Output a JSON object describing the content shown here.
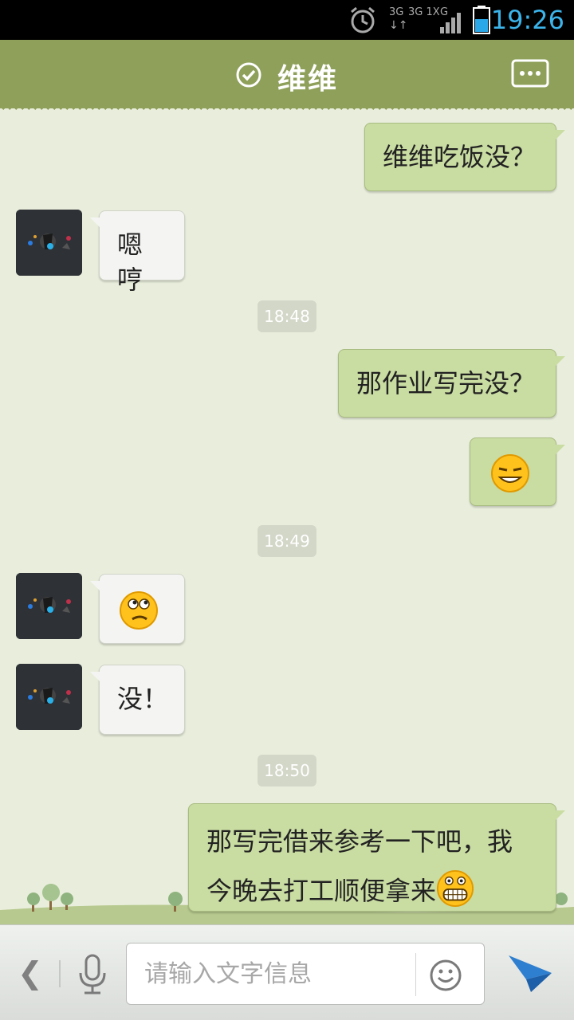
{
  "status_bar": {
    "time": "19:26",
    "network_3g": "3G",
    "network_3g_1x": "3G 1X",
    "network_g": "G"
  },
  "header": {
    "title": "维维"
  },
  "messages": [
    {
      "side": "right",
      "text": "维维吃饭没？"
    },
    {
      "side": "left",
      "text": "嗯哼"
    },
    {
      "timestamp": "18:48"
    },
    {
      "side": "right",
      "text": "那作业写完没？"
    },
    {
      "side": "right",
      "emoji": "smirk"
    },
    {
      "timestamp": "18:49"
    },
    {
      "side": "left",
      "emoji": "confused"
    },
    {
      "side": "left",
      "text": "没！"
    },
    {
      "timestamp": "18:50"
    },
    {
      "side": "right",
      "text_line1": "那写完借来参考一下吧，我",
      "text_line2": "今晚去打工顺便拿来",
      "emoji": "grin"
    }
  ],
  "input": {
    "placeholder": "请输入文字信息"
  },
  "colors": {
    "header": "#8ea05a",
    "background": "#e9eedc",
    "outgoing_bubble": "#c9dca2",
    "incoming_bubble": "#f4f5f2",
    "time_accent": "#3cb4ea",
    "send_icon": "#2f7fd0"
  }
}
